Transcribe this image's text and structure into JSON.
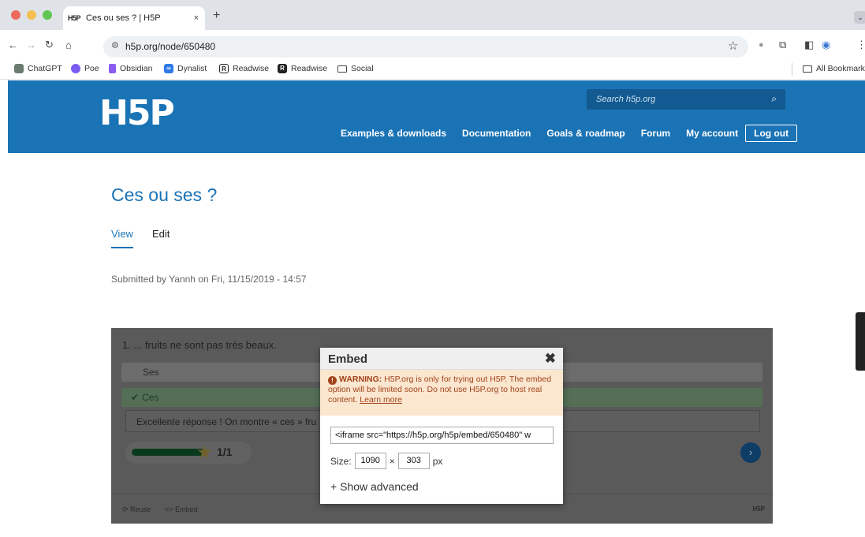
{
  "browser": {
    "tab_favicon": "H5P",
    "tab_title": "Ces ou ses ? | H5P",
    "tab_close": "×",
    "new_tab": "+",
    "url": "h5p.org/node/650480",
    "window_controls": [
      "#ed6a5e",
      "#f5bf4f",
      "#62c554"
    ],
    "bookmarks": [
      {
        "label": "ChatGPT",
        "icon": "chatgpt-icon"
      },
      {
        "label": "Poe",
        "icon": "poe-icon"
      },
      {
        "label": "Obsidian",
        "icon": "obsidian-icon"
      },
      {
        "label": "Dynalist",
        "icon": "dynalist-icon"
      },
      {
        "label": "Readwise",
        "icon": "readwise-icon"
      },
      {
        "label": "Readwise",
        "icon": "readwise-icon"
      },
      {
        "label": "Social",
        "icon": "folder-icon"
      }
    ],
    "all_bookmarks": "All Bookmarks"
  },
  "site": {
    "logo": "H5P",
    "search_placeholder": "Search h5p.org",
    "nav": [
      "Examples & downloads",
      "Documentation",
      "Goals & roadmap",
      "Forum",
      "My account",
      "Log out"
    ],
    "brand_color": "#1a73b5"
  },
  "page": {
    "title": "Ces ou ses ?",
    "tabs": [
      "View",
      "Edit"
    ],
    "submitted": "Submitted by Yannh on Fri, 11/15/2019 - 14:57"
  },
  "h5p": {
    "question": "1.  ... fruits ne sont pas très beaux.",
    "answer_wrong": "Ses",
    "answer_right": "Ces",
    "feedback": "Excellente réponse ! On montre « ces » fru",
    "score": "1/1",
    "progress": 1.0,
    "footer_reuse": "Reuse",
    "footer_embed": "Embed",
    "footer_logo": "H5P"
  },
  "embed_dialog": {
    "title": "Embed",
    "warning_strong": "WARNING:",
    "warning_text": " H5P.org is only for trying out H5P. The embed option will be limited soon. Do not use H5P.org to host real content. ",
    "warning_link": "Learn more",
    "code": "<iframe src=\"https://h5p.org/h5p/embed/650480\" w",
    "size_label": "Size:",
    "width": "1090",
    "times": "×",
    "height": "303",
    "unit": "px",
    "show_advanced": "+ Show advanced"
  }
}
